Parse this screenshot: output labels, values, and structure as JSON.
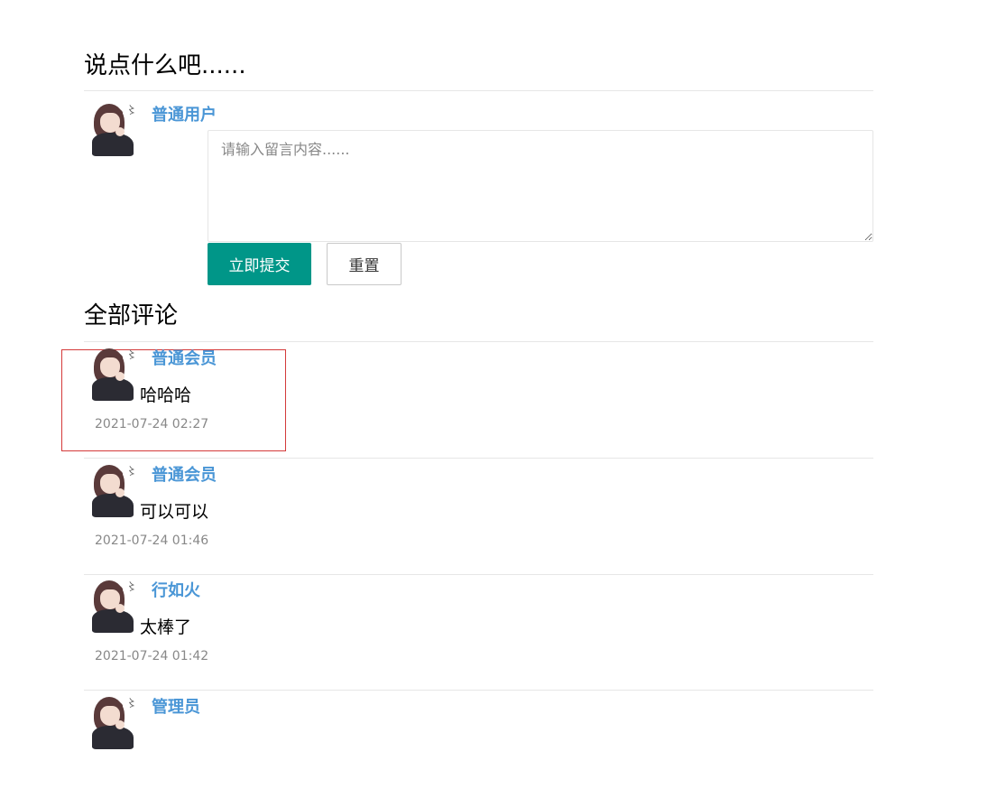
{
  "post_section": {
    "title": "说点什么吧......",
    "username": "普通用户",
    "placeholder": "请输入留言内容......",
    "submit_label": "立即提交",
    "reset_label": "重置"
  },
  "comments_section": {
    "title": "全部评论",
    "comments": [
      {
        "username": "普通会员",
        "content": "哈哈哈",
        "time": "2021-07-24 02:27"
      },
      {
        "username": "普通会员",
        "content": "可以可以",
        "time": "2021-07-24 01:46"
      },
      {
        "username": "行如火",
        "content": "太棒了",
        "time": "2021-07-24 01:42"
      },
      {
        "username": "管理员",
        "content": "",
        "time": ""
      }
    ]
  },
  "colors": {
    "accent": "#009688",
    "username": "#4a96d6",
    "highlight": "#d43a3a"
  }
}
